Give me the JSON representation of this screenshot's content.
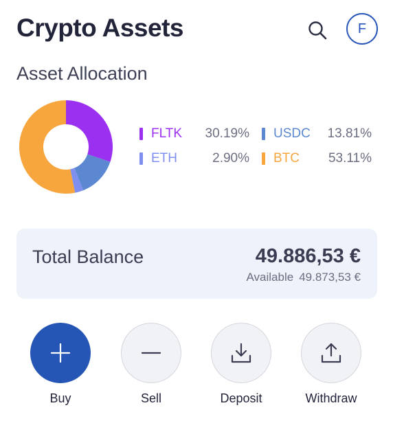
{
  "header": {
    "title": "Crypto Assets",
    "avatar_initial": "F",
    "search_icon": "search-icon"
  },
  "allocation": {
    "title": "Asset Allocation",
    "items": [
      {
        "label": "FLTK",
        "value": "30.19%",
        "fraction": 0.3019,
        "color": "#9b30f0"
      },
      {
        "label": "USDC",
        "value": "13.81%",
        "fraction": 0.1381,
        "color": "#5b88d0"
      },
      {
        "label": "ETH",
        "value": "2.90%",
        "fraction": 0.029,
        "color": "#7f8ff0"
      },
      {
        "label": "BTC",
        "value": "53.11%",
        "fraction": 0.5311,
        "color": "#f7a53d"
      }
    ]
  },
  "balance": {
    "label": "Total Balance",
    "amount": "49.886,53 €",
    "available_label": "Available",
    "available_amount": "49.873,53 €"
  },
  "actions": [
    {
      "label": "Buy",
      "icon": "plus-icon"
    },
    {
      "label": "Sell",
      "icon": "minus-icon"
    },
    {
      "label": "Deposit",
      "icon": "download-icon"
    },
    {
      "label": "Withdraw",
      "icon": "upload-icon"
    }
  ],
  "colors": {
    "primary": "#2556b5",
    "text": "#22243a",
    "card_bg": "#eef2fa"
  }
}
